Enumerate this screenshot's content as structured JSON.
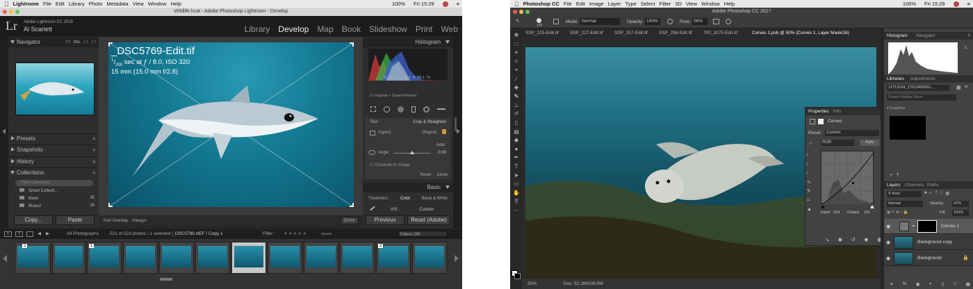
{
  "lightroom": {
    "menubar": {
      "app": "Lightroom",
      "items": [
        "File",
        "Edit",
        "Library",
        "Photo",
        "Metadata",
        "View",
        "Window",
        "Help"
      ],
      "right_items": [
        "100%",
        "Fri 15:29"
      ]
    },
    "window_title": "Wildlife.lrcat - Adobe Photoshop Lightroom - Develop",
    "identity": {
      "logo": "Lr",
      "product": "Adobe Lightroom CC 2015",
      "user": "Al Scarlett"
    },
    "modules": [
      "Library",
      "Develop",
      "Map",
      "Book",
      "Slideshow",
      "Print",
      "Web"
    ],
    "active_module": "Develop",
    "left_panel": {
      "navigator": {
        "title": "Navigator",
        "zoom_options": [
          "FIT",
          "FILL",
          "1:1",
          "1:2"
        ]
      },
      "sections": [
        "Presets",
        "Snapshots",
        "History",
        "Collections"
      ],
      "search_placeholder": "Filter Collections",
      "collections": [
        {
          "name": "Smart Collecti...",
          "count": ""
        },
        {
          "name": "blues",
          "count": "35"
        },
        {
          "name": "Blues2",
          "count": "19"
        }
      ],
      "copy_label": "Copy...",
      "paste_label": "Paste"
    },
    "image_overlay": {
      "filename": "_DSC5769-Edit.tif",
      "exposure_denominator": "200",
      "exposure_rest": "sec at ƒ / 8.0, ISO 320",
      "focal": "15 mm (15.0 mm f/2.8)"
    },
    "toolbar": {
      "overlay_label": "Tool Overlay :",
      "overlay_value": "Always",
      "done_label": "Done"
    },
    "right_panel": {
      "histogram_title": "Histogram",
      "rgb_readout": {
        "r_label": "R",
        "r": "31.0",
        "g_label": "G",
        "g": "46.4",
        "b_label": "B",
        "b": "58.1",
        "unit": "%"
      },
      "preview_label": "Original + Smart Preview",
      "tool_label": "Tool :",
      "tool_name": "Crop & Straighten",
      "aspect_label": "Aspect :",
      "aspect_value": "Original",
      "auto_label": "Auto",
      "angle_label": "Angle",
      "angle_value": "0.00",
      "constrain_label": "Constrain to Image",
      "reset_label": "Reset",
      "close_label": "Close",
      "basic_title": "Basic",
      "treatment_label": "Treatment :",
      "treatment_color": "Color",
      "treatment_bw": "Black & White",
      "wb_label": "WB :",
      "wb_value": "Custom",
      "previous_label": "Previous",
      "reset_adobe_label": "Reset (Adobe)"
    },
    "filmstrip": {
      "page_one": "1",
      "page_two": "2",
      "source": "All Photographs",
      "count_text": "521 of 523 photos / 1 selected /",
      "selected_file": "_DSC5789.NEF / Copy 1",
      "filter_label": "Filter :",
      "filters_off": "Filters Off",
      "badges": [
        "2",
        "1",
        "2"
      ]
    }
  },
  "photoshop": {
    "menubar": {
      "app": "Photoshop CC",
      "items": [
        "File",
        "Edit",
        "Image",
        "Layer",
        "Type",
        "Select",
        "Filter",
        "3D",
        "View",
        "Window",
        "Help"
      ],
      "right_items": [
        "100%",
        "Fri 15:29"
      ]
    },
    "window_title": "Adobe Photoshop CC 2017",
    "options": {
      "brush_size": "175",
      "mode_label": "Mode:",
      "mode_value": "Normal",
      "opacity_label": "Opacity:",
      "opacity_value": "100%",
      "flow_label": "Flow:",
      "flow_value": "58%"
    },
    "doc_tabs": [
      "SSP_225-Edit.tif",
      "SSP_227-Edit.tif",
      "SSP_257-Edit.tif",
      "SSP_258-Edit.tif",
      "700_3275-Edit.tif",
      "Curves 1.psb @ 50% (Curves 1, Layer Mask/16)"
    ],
    "status": {
      "zoom": "50%",
      "doc": "Doc: 52.1M/108.5M"
    },
    "properties": {
      "tabs": [
        "Properties",
        "Info"
      ],
      "layer_name": "Curves",
      "preset_label": "Preset:",
      "preset_value": "Custom",
      "channel": "RGB",
      "auto_label": "Auto",
      "input_label": "Input:",
      "input_value": "154",
      "output_label": "Output:",
      "output_value": "101"
    },
    "right_panels": {
      "histogram_tabs": [
        "Histogram",
        "Navigator"
      ],
      "libraries_tabs": [
        "Libraries",
        "Adjustments"
      ],
      "library_name": "12713104_17013492001...",
      "search_placeholder": "Search Adobe Stock",
      "graphics_label": "Graphics",
      "layers_tabs": [
        "Layers",
        "Channels",
        "Paths"
      ],
      "kind_label": "Kind",
      "blend_mode": "Normal",
      "opacity_label": "Opacity:",
      "opacity_value": "47%",
      "fill_label": "Fill:",
      "fill_value": "100%",
      "layers": [
        {
          "name": "Curves 1"
        },
        {
          "name": "Background copy"
        },
        {
          "name": "Background"
        }
      ]
    }
  }
}
